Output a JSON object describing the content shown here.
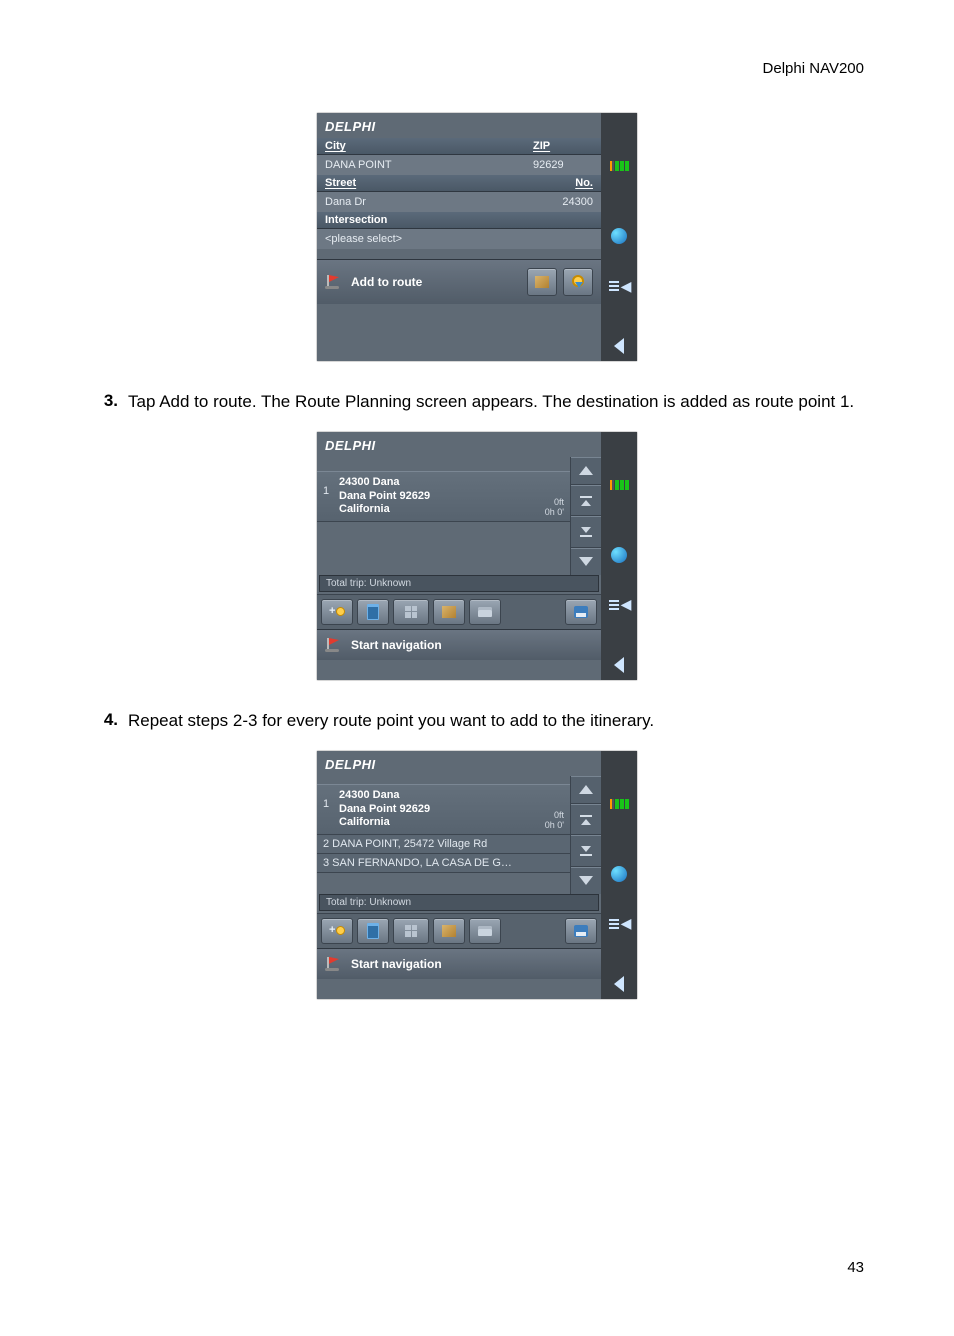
{
  "header": {
    "product": "Delphi NAV200"
  },
  "footer": {
    "page": "43"
  },
  "steps": {
    "s3": {
      "num": "3.",
      "text": "Tap Add to route. The Route Planning screen appears. The destination is added as route point 1."
    },
    "s4": {
      "num": "4.",
      "text": "Repeat steps 2-3 for every route point you want to add to the itinerary."
    }
  },
  "shot1": {
    "brand": "DELPHI",
    "labels": {
      "city": "City",
      "zip": "ZIP",
      "street": "Street",
      "no": "No.",
      "intersection": "Intersection"
    },
    "values": {
      "city": "DANA POINT",
      "zip": "92629",
      "street": "Dana Dr",
      "no": "24300",
      "intersection": "<please select>"
    },
    "buttons": {
      "primary": "Add to route"
    }
  },
  "shot2": {
    "brand": "DELPHI",
    "route": [
      {
        "num": "1",
        "line1": "24300 Dana",
        "line2": "Dana Point 92629",
        "line3": "California",
        "dist": "0ft",
        "time": "0h 0'"
      }
    ],
    "status": "Total trip: Unknown",
    "buttons": {
      "primary": "Start navigation"
    }
  },
  "shot3": {
    "brand": "DELPHI",
    "route_primary": {
      "num": "1",
      "line1": "24300 Dana",
      "line2": "Dana Point 92629",
      "line3": "California",
      "dist": "0ft",
      "time": "0h 0'"
    },
    "route_extra": [
      "2 DANA POINT, 25472 Village Rd",
      "3 SAN FERNANDO, LA CASA DE G…"
    ],
    "status": "Total trip: Unknown",
    "buttons": {
      "primary": "Start navigation"
    }
  }
}
